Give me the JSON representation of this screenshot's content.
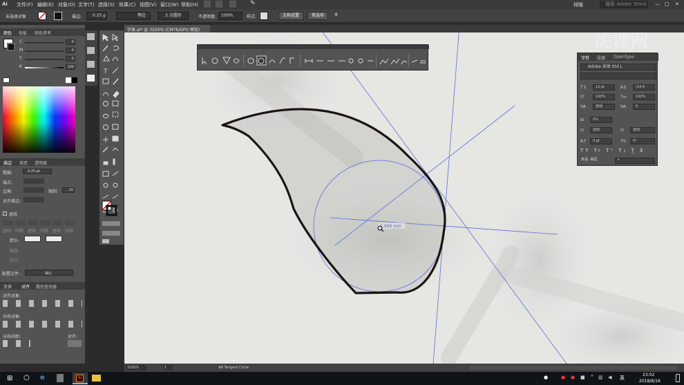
{
  "app": {
    "logo": "Ai"
  },
  "menu": [
    "文件(F)",
    "编辑(E)",
    "对象(O)",
    "文字(T)",
    "选择(S)",
    "效果(C)",
    "视图(V)",
    "窗口(W)",
    "帮助(H)"
  ],
  "menu_right": {
    "workspace": "排版",
    "search": "搜索 Adobe Stock"
  },
  "watermark": "虎课网",
  "control_bar": {
    "no_selection": "未选择对象",
    "stroke_label": "描边:",
    "stroke_value": "0.25 p",
    "stroke_profile": "等比",
    "brush": "3 点圆形",
    "opacity_label": "不透明度:",
    "opacity_value": "100%",
    "style_label": "样式:",
    "doc_setup": "文档设置",
    "preferences": "首选项"
  },
  "doc_tab": {
    "title": "字体.ai* @ 3200% (CMYK/GPU 预览)"
  },
  "color_panel": {
    "tabs": [
      "颜色",
      "色板",
      "颜色参考"
    ],
    "channels": [
      {
        "label": "C",
        "value": "0"
      },
      {
        "label": "M",
        "value": "0"
      },
      {
        "label": "Y",
        "value": "0"
      },
      {
        "label": "K",
        "value": "100"
      }
    ]
  },
  "stroke_panel": {
    "tabs": [
      "描边",
      "渐变",
      "透明度"
    ],
    "weight_label": "粗细:",
    "weight_value": "0.25 pt",
    "cap_label": "端点:",
    "corner_label": "边角:",
    "limit_label": "限制:",
    "limit_value": "10",
    "align_label": "对齐描边:",
    "dashed_label": "虚线",
    "dash_labels": [
      "虚线",
      "间隙",
      "虚线",
      "间隙",
      "虚线",
      "间隙"
    ],
    "arrow_label": "箭头:",
    "scale_label": "缩放:",
    "align2_label": "对齐:",
    "profile_label": "配置文件:",
    "profile_value": "等比"
  },
  "align_panel": {
    "tabs": [
      "变换",
      "对齐",
      "路径查找器"
    ],
    "align_objects": "对齐对象:",
    "distribute_objects": "分布对象:",
    "distribute_spacing": "分布间距:",
    "align_to": "对齐:"
  },
  "char_panel": {
    "tabs": [
      "字符",
      "段落",
      "OpenType"
    ],
    "font": "Adobe 宋体 Std L",
    "font_size": "12 pt",
    "leading": "(14.4",
    "hscale": "100%",
    "vscale": "100%",
    "kerning": "自动",
    "tracking": "0",
    "tsume": "0%",
    "aki_left": "自动",
    "aki_right": "自动",
    "baseline": "0 pt",
    "rotation": "0°",
    "language": "英语: 美国",
    "aa": "ª"
  },
  "canvas": {
    "measure_label": "1.996 mm"
  },
  "status": {
    "zoom": "3200%",
    "page": "1",
    "tool_status": "AB Tangent Circle"
  },
  "taskbar": {
    "time": "23:02",
    "date": "2018/8/16",
    "ime": "英"
  },
  "colors": {
    "accent": "#ff9a00",
    "guide": "#5b6ed8",
    "path": "#1a1412"
  }
}
